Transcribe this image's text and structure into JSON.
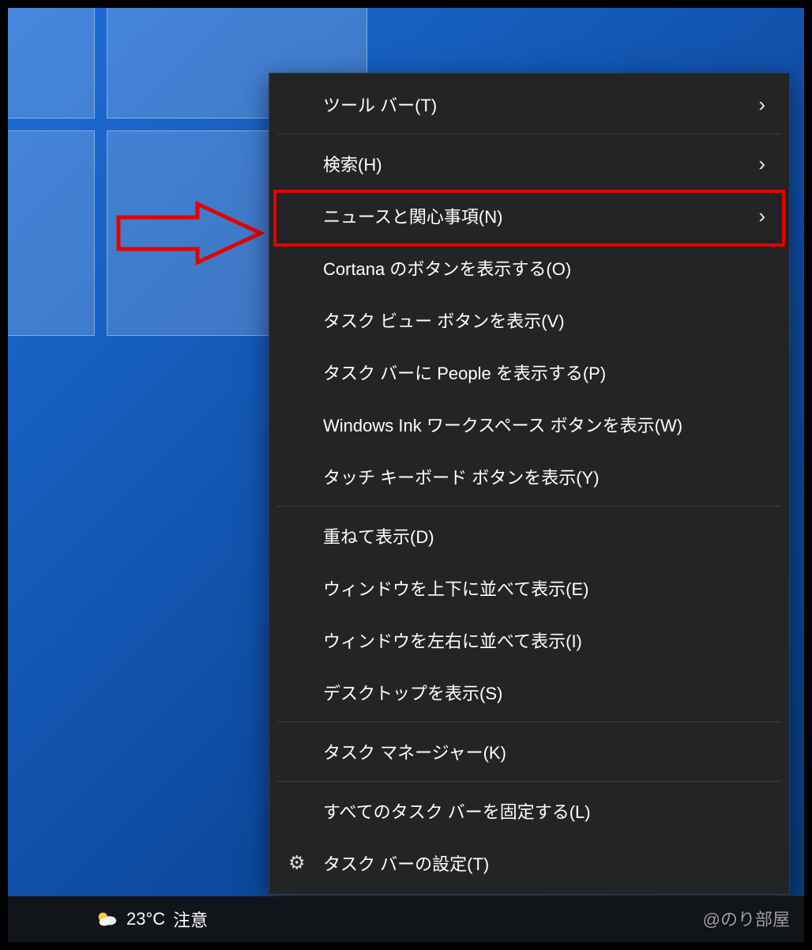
{
  "menu": {
    "items": [
      {
        "id": "toolbars",
        "label": "ツール バー(T)",
        "submenu": true
      },
      {
        "divider": true
      },
      {
        "id": "search",
        "label": "検索(H)",
        "submenu": true
      },
      {
        "id": "news",
        "label": "ニュースと関心事項(N)",
        "submenu": true,
        "highlighted": true
      },
      {
        "id": "cortana",
        "label": "Cortana のボタンを表示する(O)"
      },
      {
        "id": "taskview",
        "label": "タスク ビュー ボタンを表示(V)"
      },
      {
        "id": "people",
        "label": "タスク バーに People を表示する(P)"
      },
      {
        "id": "ink",
        "label": "Windows Ink ワークスペース ボタンを表示(W)"
      },
      {
        "id": "touchkb",
        "label": "タッチ キーボード ボタンを表示(Y)"
      },
      {
        "divider": true
      },
      {
        "id": "cascade",
        "label": "重ねて表示(D)"
      },
      {
        "id": "stacked",
        "label": "ウィンドウを上下に並べて表示(E)"
      },
      {
        "id": "sidebyside",
        "label": "ウィンドウを左右に並べて表示(I)"
      },
      {
        "id": "showdesktop",
        "label": "デスクトップを表示(S)"
      },
      {
        "divider": true
      },
      {
        "id": "taskmgr",
        "label": "タスク マネージャー(K)"
      },
      {
        "divider": true
      },
      {
        "id": "lock",
        "label": "すべてのタスク バーを固定する(L)"
      },
      {
        "id": "settings",
        "label": "タスク バーの設定(T)",
        "icon": "gear"
      }
    ]
  },
  "taskbar": {
    "weather_temp": "23°C",
    "weather_text": "注意"
  },
  "watermark": "@のり部屋",
  "annotation": {
    "arrow_color": "#e60000",
    "highlight_color": "#e60000"
  }
}
